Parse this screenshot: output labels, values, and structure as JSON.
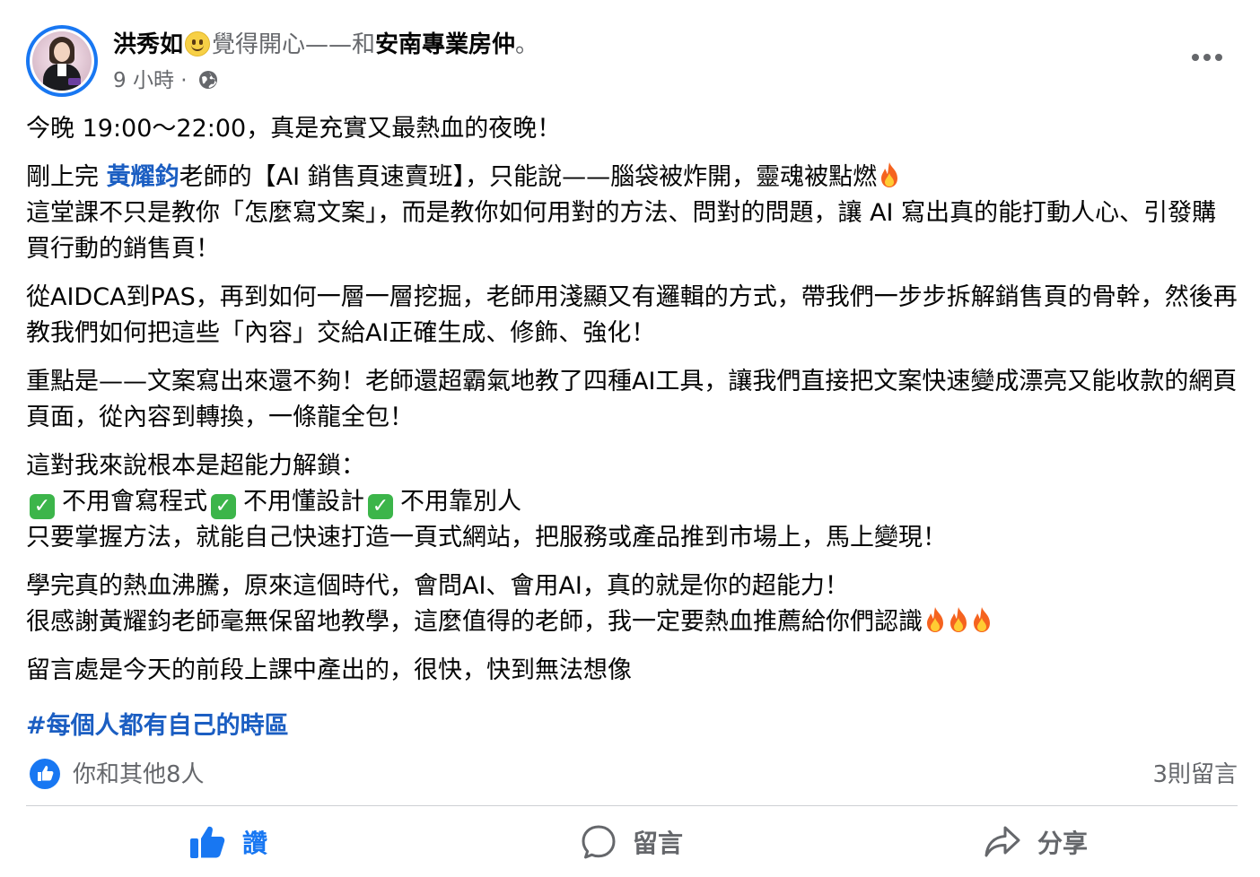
{
  "header": {
    "author": "洪秀如",
    "feeling": "覺得開心——和",
    "with_page": "安南專業房仲",
    "suffix": "。",
    "time": "9 小時",
    "dot": "·"
  },
  "post": {
    "p1": "今晚 19:00～22:00，真是充實又最熱血的夜晚！",
    "p2_pre": "剛上完 ",
    "p2_mention": "黃耀鈞",
    "p2_post": "老師的【AI 銷售頁速賣班】，只能說——腦袋被炸開，靈魂被點燃",
    "p2_line2": "這堂課不只是教你「怎麼寫文案」，而是教你如何用對的方法、問對的問題，讓 AI 寫出真的能打動人心、引發購買行動的銷售頁！",
    "p3": "從AIDCA到PAS，再到如何一層一層挖掘，老師用淺顯又有邏輯的方式，帶我們一步步拆解銷售頁的骨幹，然後再教我們如何把這些「內容」交給AI正確生成、修飾、強化！",
    "p4": "重點是——文案寫出來還不夠！老師還超霸氣地教了四種AI工具，讓我們直接把文案快速變成漂亮又能收款的網頁頁面，從內容到轉換，一條龍全包！",
    "p5_line1": "這對我來說根本是超能力解鎖：",
    "check1": "不用會寫程式",
    "check2": "不用懂設計",
    "check3": "不用靠別人",
    "p5_line3": "只要掌握方法，就能自己快速打造一頁式網站，把服務或產品推到市場上，馬上變現！",
    "p6_line1": "學完真的熱血沸騰，原來這個時代，會問AI、會用AI，真的就是你的超能力！",
    "p6_line2": "很感謝黃耀鈞老師毫無保留地教學，這麼值得的老師，我一定要熱血推薦給你們認識",
    "p7": "留言處是今天的前段上課中產出的，很快，快到無法想像",
    "hashtag": "#每個人都有自己的時區"
  },
  "reactions": {
    "summary": "你和其他8人",
    "comments": "3則留言"
  },
  "actions": {
    "like": "讚",
    "comment": "留言",
    "share": "分享"
  },
  "colors": {
    "link": "#1b5ec2",
    "brand": "#1877f2",
    "muted": "#65676b"
  },
  "icons": [
    "smiley-icon",
    "globe-icon",
    "more-icon",
    "fire-icon",
    "check-icon",
    "like-icon",
    "comment-icon",
    "share-icon"
  ]
}
